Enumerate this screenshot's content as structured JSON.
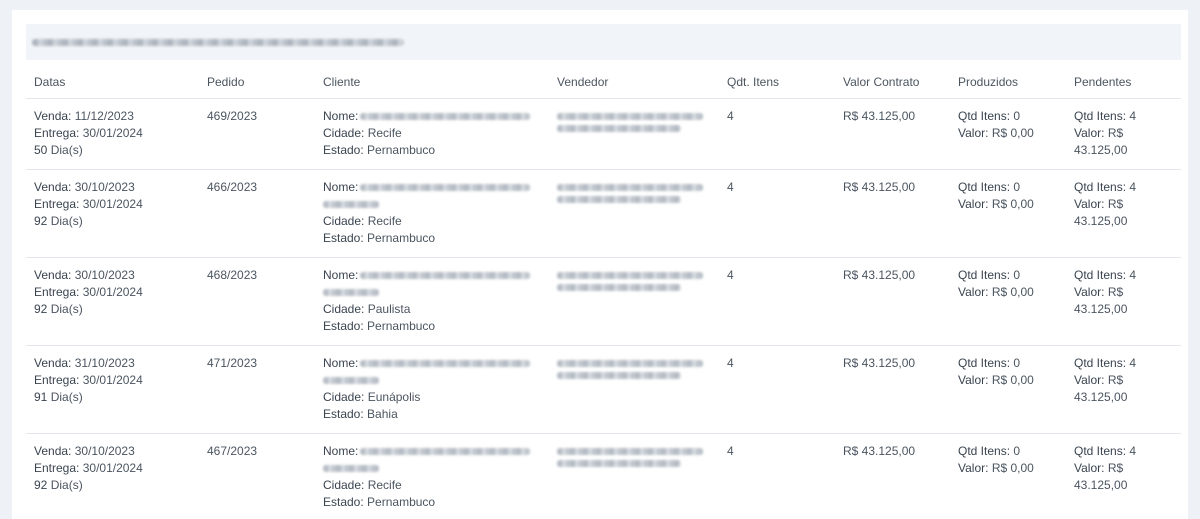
{
  "columns": {
    "datas": "Datas",
    "pedido": "Pedido",
    "cliente": "Cliente",
    "vendedor": "Vendedor",
    "qtd_itens": "Qdt. Itens",
    "valor_contrato": "Valor Contrato",
    "produzidos": "Produzidos",
    "pendentes": "Pendentes"
  },
  "labels": {
    "venda": "Venda:",
    "entrega": "Entrega:",
    "dias_suffix": "Dia(s)",
    "nome": "Nome:",
    "cidade": "Cidade:",
    "estado": "Estado:",
    "qtd_itens": "Qtd Itens:",
    "valor": "Valor:"
  },
  "rows": [
    {
      "venda": "11/12/2023",
      "entrega": "30/01/2024",
      "dias": "50",
      "pedido": "469/2023",
      "cidade": "Recife",
      "estado": "Pernambuco",
      "qtd": "4",
      "valor_contrato": "R$ 43.125,00",
      "prod_qtd": "0",
      "prod_valor": "R$ 0,00",
      "pend_qtd": "4",
      "pend_valor": "R$ 43.125,00"
    },
    {
      "venda": "30/10/2023",
      "entrega": "30/01/2024",
      "dias": "92",
      "pedido": "466/2023",
      "cidade": "Recife",
      "estado": "Pernambuco",
      "qtd": "4",
      "valor_contrato": "R$ 43.125,00",
      "prod_qtd": "0",
      "prod_valor": "R$ 0,00",
      "pend_qtd": "4",
      "pend_valor": "R$ 43.125,00"
    },
    {
      "venda": "30/10/2023",
      "entrega": "30/01/2024",
      "dias": "92",
      "pedido": "468/2023",
      "cidade": "Paulista",
      "estado": "Pernambuco",
      "qtd": "4",
      "valor_contrato": "R$ 43.125,00",
      "prod_qtd": "0",
      "prod_valor": "R$ 0,00",
      "pend_qtd": "4",
      "pend_valor": "R$ 43.125,00"
    },
    {
      "venda": "31/10/2023",
      "entrega": "30/01/2024",
      "dias": "91",
      "pedido": "471/2023",
      "cidade": "Eunápolis",
      "estado": "Bahia",
      "qtd": "4",
      "valor_contrato": "R$ 43.125,00",
      "prod_qtd": "0",
      "prod_valor": "R$ 0,00",
      "pend_qtd": "4",
      "pend_valor": "R$ 43.125,00"
    },
    {
      "venda": "30/10/2023",
      "entrega": "30/01/2024",
      "dias": "92",
      "pedido": "467/2023",
      "cidade": "Recife",
      "estado": "Pernambuco",
      "qtd": "4",
      "valor_contrato": "R$ 43.125,00",
      "prod_qtd": "0",
      "prod_valor": "R$ 0,00",
      "pend_qtd": "4",
      "pend_valor": "R$ 43.125,00"
    }
  ]
}
